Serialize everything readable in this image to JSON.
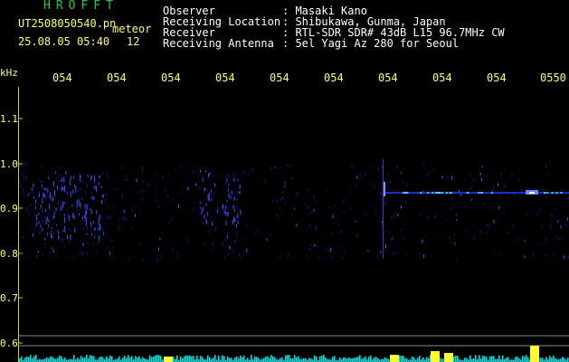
{
  "header": {
    "logo": "HROFFT",
    "filename": "UT2508050540.pn",
    "mode": "meteor",
    "datetime": "25.08.05 05:40",
    "count": "12",
    "labels": {
      "observer": "Observer",
      "location": "Receiving Location",
      "receiver": "Receiver",
      "antenna": "Receiving Antenna"
    },
    "values": {
      "observer": ": Masaki Kano",
      "location": ": Shibukawa, Gunma, Japan",
      "receiver": ": RTL-SDR SDR# 43dB L15 96.7MHz CW",
      "antenna": ": 5el Yagi Az 280 for Seoul"
    }
  },
  "axis": {
    "unit": "kHz",
    "time_ticks": [
      "054",
      "054",
      "054",
      "054",
      "054",
      "054",
      "054",
      "054",
      "054",
      "0550"
    ],
    "freq_ticks": [
      "1.1",
      "1.0",
      "0.9",
      "0.8",
      "0.7",
      "0.6"
    ]
  },
  "colors": {
    "background": "#000000",
    "label_yellow": "#ffff66",
    "logo_green": "#22cc44",
    "signal_blue": "#2233ff",
    "spectrum_cyan": "#00ffff"
  }
}
